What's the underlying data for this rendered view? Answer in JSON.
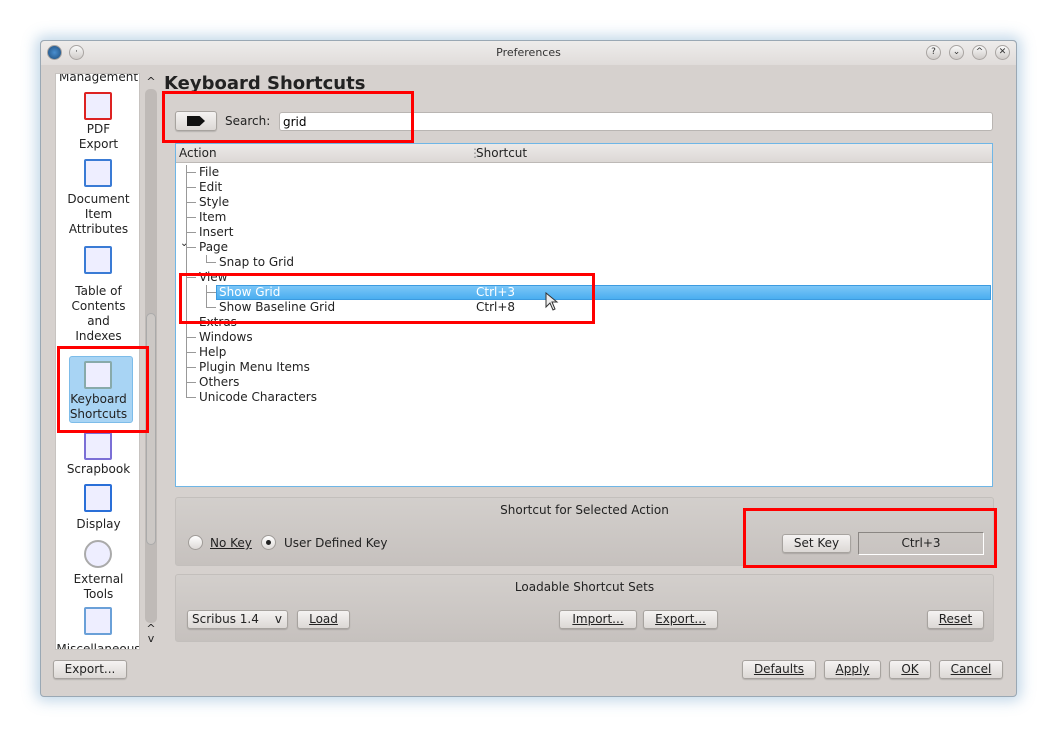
{
  "window": {
    "title": "Preferences",
    "buttons": [
      "?",
      "⌄",
      "^",
      "✕"
    ]
  },
  "sidebar": {
    "items": [
      {
        "label": "Management",
        "icon": "management-icon"
      },
      {
        "label": "PDF\nExport",
        "lines": [
          "PDF",
          "Export"
        ],
        "icon": "pdf-icon"
      },
      {
        "lines": [
          "Document",
          "Item",
          "Attributes"
        ],
        "icon": "document-attributes-icon"
      },
      {
        "lines": [
          "Table of",
          "Contents",
          "and",
          "Indexes"
        ],
        "icon": "toc-icon"
      },
      {
        "lines": [
          "Keyboard",
          "Shortcuts"
        ],
        "icon": "keyboard-icon",
        "selected": true
      },
      {
        "lines": [
          "Scrapbook"
        ],
        "icon": "scrapbook-icon"
      },
      {
        "lines": [
          "Display"
        ],
        "icon": "display-icon"
      },
      {
        "lines": [
          "External",
          "Tools"
        ],
        "icon": "gear-icon"
      },
      {
        "lines": [
          "Miscellaneous"
        ],
        "icon": "misc-icon"
      }
    ]
  },
  "main": {
    "title": "Keyboard Shortcuts",
    "search": {
      "label": "Search:",
      "value": "grid",
      "clear_icon": "clear-text-icon"
    },
    "tree": {
      "columns": [
        "Action",
        "Shortcut"
      ],
      "rows": [
        {
          "label": "File",
          "level": 0
        },
        {
          "label": "Edit",
          "level": 0
        },
        {
          "label": "Style",
          "level": 0
        },
        {
          "label": "Item",
          "level": 0
        },
        {
          "label": "Insert",
          "level": 0
        },
        {
          "label": "Page",
          "level": 0,
          "expanded": true
        },
        {
          "label": "Snap to Grid",
          "level": 1
        },
        {
          "label": "View",
          "level": 0,
          "expanded": true
        },
        {
          "label": "Show Grid",
          "level": 1,
          "shortcut": "Ctrl+3",
          "selected": true
        },
        {
          "label": "Show Baseline Grid",
          "level": 1,
          "shortcut": "Ctrl+8"
        },
        {
          "label": "Extras",
          "level": 0
        },
        {
          "label": "Windows",
          "level": 0
        },
        {
          "label": "Help",
          "level": 0
        },
        {
          "label": "Plugin Menu Items",
          "level": 0
        },
        {
          "label": "Others",
          "level": 0
        },
        {
          "label": "Unicode Characters",
          "level": 0
        }
      ]
    },
    "shortcut_group": {
      "title": "Shortcut for Selected Action",
      "no_key": "No Key",
      "user_defined": "User Defined Key",
      "selected": "User Defined Key",
      "set_key": "Set Key",
      "current": "Ctrl+3"
    },
    "sets_group": {
      "title": "Loadable Shortcut Sets",
      "combo": "Scribus 1.4",
      "load": "Load",
      "import": "Import...",
      "export": "Export...",
      "reset": "Reset"
    }
  },
  "footer": {
    "export": "Export...",
    "defaults": "Defaults",
    "apply": "Apply",
    "ok": "OK",
    "cancel": "Cancel"
  },
  "colors": {
    "selection": "#5cb6f2",
    "highlight_box": "#ff0000"
  }
}
